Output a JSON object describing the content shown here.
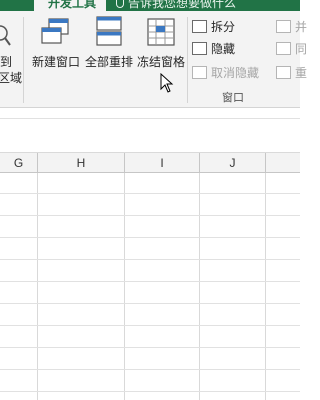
{
  "ribbon_tab": {
    "active_label": "开发工具",
    "tellme_text": "告诉我您想要做什么"
  },
  "buttons": {
    "partial_left_line1": "到",
    "partial_left_line2": "区域",
    "new_window": "新建窗口",
    "arrange_all": "全部重排",
    "freeze_panes": "冻结窗格"
  },
  "small_items": {
    "split": "拆分",
    "hide": "隐藏",
    "unhide": "取消隐藏",
    "partial_col1": "并",
    "partial_col2": "同",
    "partial_col3": "重"
  },
  "group": {
    "window_label": "窗口"
  },
  "columns": [
    "G",
    "H",
    "I",
    "J"
  ],
  "colors": {
    "brand": "#217346",
    "ribbon_bg": "#f3f3f3",
    "grid_line": "#e1e1e1"
  }
}
